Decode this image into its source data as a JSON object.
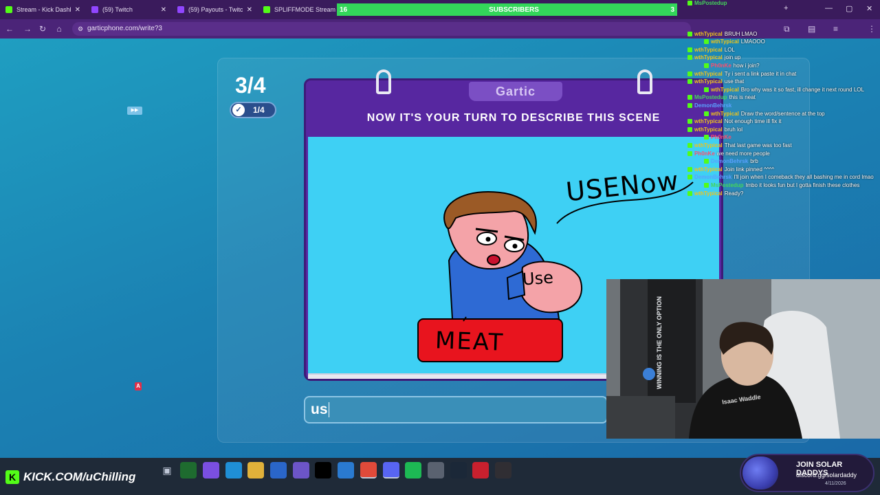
{
  "browser": {
    "tabs": [
      {
        "title": "Stream - Kick Dashbo",
        "favicon": "kick"
      },
      {
        "title": "(59) Twitch",
        "favicon": "twitch"
      },
      {
        "title": "(59) Payouts - Twitch",
        "favicon": "twitch"
      },
      {
        "title": "SPLIFFMODE Stream",
        "favicon": "kick"
      }
    ],
    "url": "garticphone.com/write?3"
  },
  "subscribers_banner": {
    "left": "16",
    "label": "SUBSCRIBERS",
    "right": "3"
  },
  "game": {
    "round": "3/4",
    "done_count": "1/4",
    "logo": "Gartic",
    "prompt": "NOW IT'S YOUR TURN TO DESCRIBE THIS SCENE",
    "drawing_texts": {
      "top_right": "USENow",
      "sign": "MEAT",
      "hand": "Use"
    },
    "answer_value": "us",
    "small_badge": "▶▶",
    "a_badge": "A"
  },
  "chat": [
    {
      "user": "MsPostedup",
      "message": "",
      "user_color": "#44d65a"
    },
    {
      "user": "wthTypical",
      "message": "BRUH LMAO",
      "user_color": "#f0c419"
    },
    {
      "user": "wthTypical",
      "message": "LMAOOO",
      "user_color": "#f0c419"
    },
    {
      "user": "wthTypical",
      "message": "LOL",
      "user_color": "#f0c419"
    },
    {
      "user": "wthTypical",
      "message": "join up",
      "user_color": "#f0c419"
    },
    {
      "user": "Ph0nKe",
      "message": "how i join?",
      "user_color": "#ff4d6d"
    },
    {
      "user": "wthTypical",
      "message": "Ty i sent a link paste it in chat",
      "user_color": "#f0c419"
    },
    {
      "user": "wthTypical",
      "message": "use that",
      "user_color": "#f0c419"
    },
    {
      "user": "wthTypical",
      "message": "Bro why was it so fast, ill change it next round LOL",
      "user_color": "#f0c419"
    },
    {
      "user": "MsPostedup",
      "message": "this is neat",
      "user_color": "#44d65a"
    },
    {
      "user": "DemonBehrsk",
      "message": "",
      "user_color": "#5aa0ff"
    },
    {
      "user": "wthTypical",
      "message": "Draw the word/sentence at the top",
      "user_color": "#f0c419"
    },
    {
      "user": "wthTypical",
      "message": "Not enough time ill fix it",
      "user_color": "#f0c419"
    },
    {
      "user": "wthTypical",
      "message": "bruh lol",
      "user_color": "#f0c419"
    },
    {
      "user": "Ph0nKe",
      "message": "",
      "user_color": "#ff4d6d"
    },
    {
      "user": "wthTypical",
      "message": "That last game was too fast",
      "user_color": "#f0c419"
    },
    {
      "user": "Ph0nKe",
      "message": "we need more people",
      "user_color": "#ff4d6d"
    },
    {
      "user": "DemonBehrsk",
      "message": "brb",
      "user_color": "#5aa0ff"
    },
    {
      "user": "wthTypical",
      "message": "Join link pinned ^^^^",
      "user_color": "#f0c419"
    },
    {
      "user": "DemonBehrsk",
      "message": "I'll join when I comeback they all bashing me in cord lmao",
      "user_color": "#5aa0ff"
    },
    {
      "user": "MsPostedup",
      "message": "lmbo it looks fun but I gotta finish these clothes",
      "user_color": "#44d65a"
    },
    {
      "user": "wthTypical",
      "message": "Ready?",
      "user_color": "#f0c419"
    }
  ],
  "taskbar": {
    "channel": "KICK.COM/uChilling"
  },
  "promo": {
    "title": "JOIN SOLAR DADDYS",
    "subtitle": "discord.gg/solardaddy"
  },
  "webcam": {
    "banner_text": "WINNING IS THE ONLY OPTION",
    "shirt_text": "Isaac Waddle"
  },
  "tray": {
    "date": "4/11/2026"
  },
  "colors": {
    "page_bg": "#1b82b3",
    "book_bg": "#5727a0",
    "canvas_bg": "#3ed0f4",
    "kick_green": "#53fc18",
    "subs_green": "#33d65a"
  }
}
